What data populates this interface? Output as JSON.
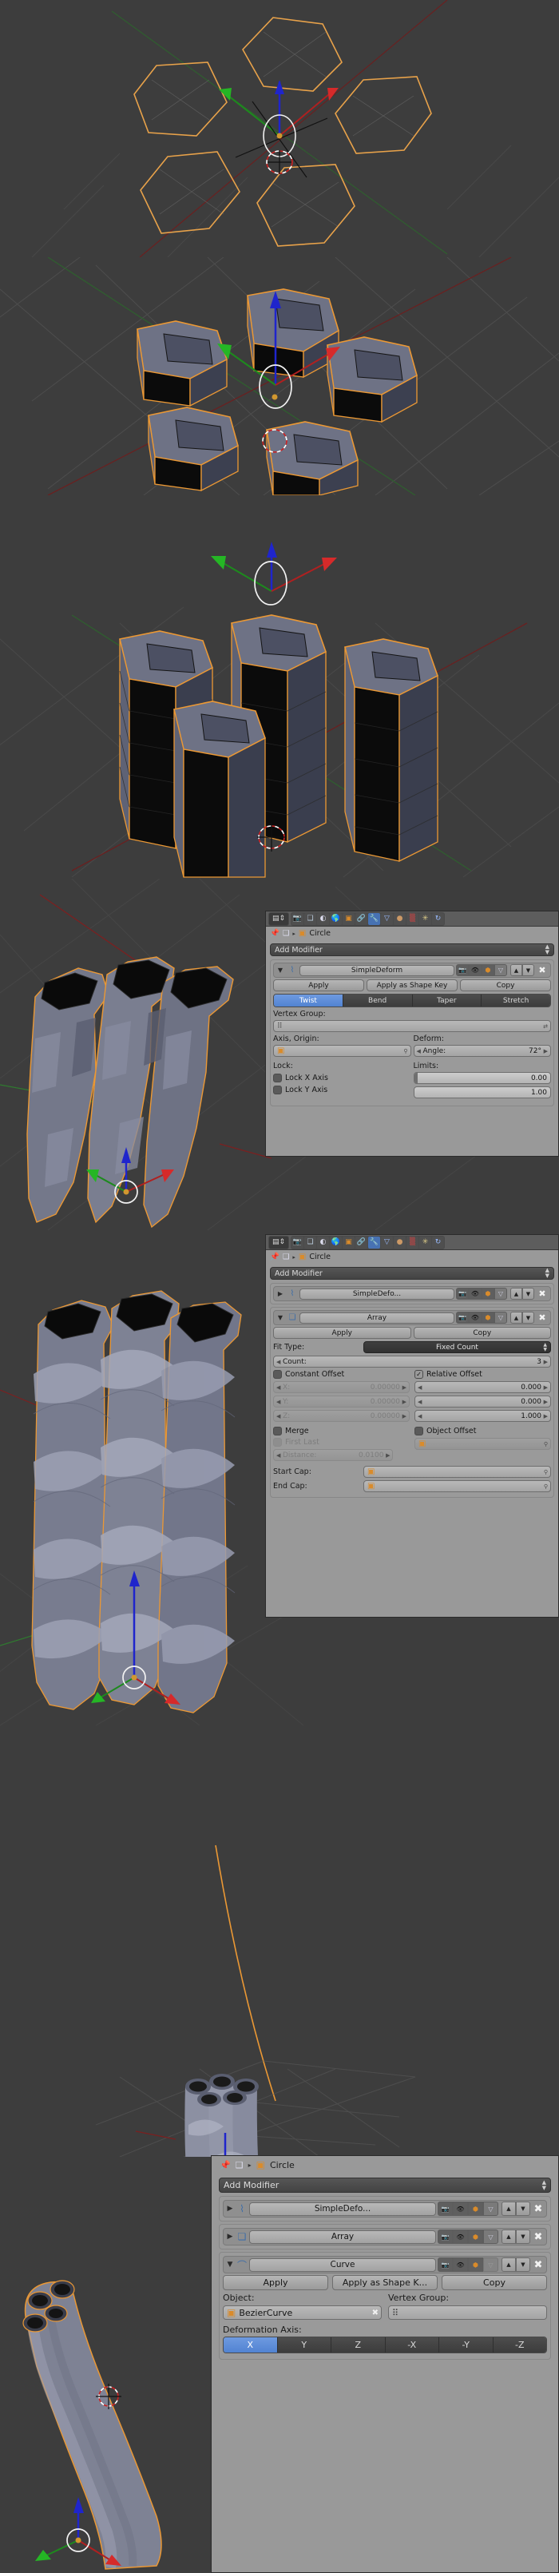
{
  "app": "Blender — 3D Viewport with Properties Editor (Modifier stack)",
  "viewports": [
    {
      "name": "viewport-hexagon-outlines",
      "caption": "Five hexagon wireframe outlines arranged radially, top view, manipulator gizmo at origin"
    },
    {
      "name": "viewport-hexagon-extruded",
      "caption": "Five extruded hexagonal prisms, shaded, selected in orange"
    },
    {
      "name": "viewport-hexagon-tall",
      "caption": "Four tall hexagonal columns extruded upward with subdivision wireframe"
    },
    {
      "name": "viewport-twisted-lowpoly",
      "caption": "Twisted low-poly hexagonal columns after SimpleDeform twist"
    },
    {
      "name": "viewport-twisted-array",
      "caption": "Twisted columns arrayed vertically via Array modifier"
    },
    {
      "name": "viewport-curve-and-object",
      "caption": "Bezier curve path above, twisted column object below"
    },
    {
      "name": "viewport-curved-result",
      "caption": "Twisted column deformed along the bezier curve"
    }
  ],
  "panels": {
    "panel1": {
      "toolbar": {
        "editor_icon": "editor-type-icon",
        "tabs": [
          {
            "name": "render-tab",
            "glyph": "📷",
            "active": false
          },
          {
            "name": "render-layers-tab",
            "glyph": "❑",
            "active": false
          },
          {
            "name": "scene-tab",
            "glyph": "◐",
            "active": false
          },
          {
            "name": "world-tab",
            "glyph": "🌎",
            "active": false
          },
          {
            "name": "object-tab",
            "glyph": "▣",
            "active": false
          },
          {
            "name": "constraints-tab",
            "glyph": "🔗",
            "active": false
          },
          {
            "name": "modifiers-tab",
            "glyph": "🔧",
            "active": true
          },
          {
            "name": "data-tab",
            "glyph": "▽",
            "active": false
          },
          {
            "name": "material-tab",
            "glyph": "●",
            "active": false
          },
          {
            "name": "texture-tab",
            "glyph": "▒",
            "active": false
          },
          {
            "name": "particles-tab",
            "glyph": "✴",
            "active": false
          },
          {
            "name": "physics-tab",
            "glyph": "↻",
            "active": false
          }
        ]
      },
      "breadcrumb": {
        "pin": "pin-icon",
        "object_icon": "object-icon",
        "sep": "▸",
        "object_name": "Circle"
      },
      "add_modifier": "Add Modifier",
      "modifier": {
        "name": "SimpleDeform",
        "expanded": true,
        "apply": "Apply",
        "apply_shape_key": "Apply as Shape Key",
        "copy": "Copy",
        "modes": [
          "Twist",
          "Bend",
          "Taper",
          "Stretch"
        ],
        "mode_selected": "Twist",
        "vertex_group_label": "Vertex Group:",
        "vertex_group_value": "",
        "axis_origin_label": "Axis, Origin:",
        "axis_origin_value": "",
        "deform_label": "Deform:",
        "angle_label": "Angle:",
        "angle_value": "72°",
        "lock_label": "Lock:",
        "lock_x": "Lock X Axis",
        "lock_y": "Lock Y Axis",
        "limits_label": "Limits:",
        "limit_min": "0.00",
        "limit_max": "1.00"
      }
    },
    "panel2": {
      "breadcrumb": {
        "object_name": "Circle"
      },
      "add_modifier": "Add Modifier",
      "modifier_collapsed": {
        "name": "SimpleDefo...",
        "expanded": false
      },
      "modifier": {
        "name": "Array",
        "expanded": true,
        "apply": "Apply",
        "copy": "Copy",
        "fit_type_label": "Fit Type:",
        "fit_type_value": "Fixed Count",
        "count_label": "Count:",
        "count_value": "3",
        "constant_offset_label": "Constant Offset",
        "constant_offset_checked": false,
        "constant_offset_x_label": "X:",
        "constant_offset_y_label": "Y:",
        "constant_offset_z_label": "Z:",
        "constant_offset_x": "0.00000",
        "constant_offset_y": "0.00000",
        "constant_offset_z": "0.00000",
        "relative_offset_label": "Relative Offset",
        "relative_offset_checked": true,
        "relative_offset_x": "0.000",
        "relative_offset_y": "0.000",
        "relative_offset_z": "1.000",
        "merge_label": "Merge",
        "merge_checked": false,
        "first_last_label": "First Last",
        "first_last_checked": false,
        "distance_label": "Distance:",
        "distance_value": "0.0100",
        "object_offset_label": "Object Offset",
        "object_offset_checked": false,
        "object_offset_value": "",
        "start_cap_label": "Start Cap:",
        "start_cap_value": "",
        "end_cap_label": "End Cap:",
        "end_cap_value": ""
      }
    },
    "panel3": {
      "breadcrumb": {
        "object_name": "Circle"
      },
      "add_modifier": "Add Modifier",
      "collapsed": [
        {
          "name": "SimpleDefo..."
        },
        {
          "name": "Array"
        }
      ],
      "modifier": {
        "name": "Curve",
        "expanded": true,
        "apply": "Apply",
        "apply_shape_key": "Apply as Shape K...",
        "copy": "Copy",
        "object_label": "Object:",
        "object_value": "BezierCurve",
        "vertex_group_label": "Vertex Group:",
        "vertex_group_value": "",
        "deformation_axis_label": "Deformation Axis:",
        "axes": [
          "X",
          "Y",
          "Z",
          "-X",
          "-Y",
          "-Z"
        ],
        "axis_selected": "X"
      }
    }
  },
  "colors": {
    "viewport_bg": "#3d3d3d",
    "panel_bg": "#999999",
    "accent_blue": "#5183d2",
    "selected_orange": "#eb9834",
    "axis_x_red": "#cc3333",
    "axis_y_green": "#33aa33",
    "axis_z_blue": "#2233cc"
  }
}
